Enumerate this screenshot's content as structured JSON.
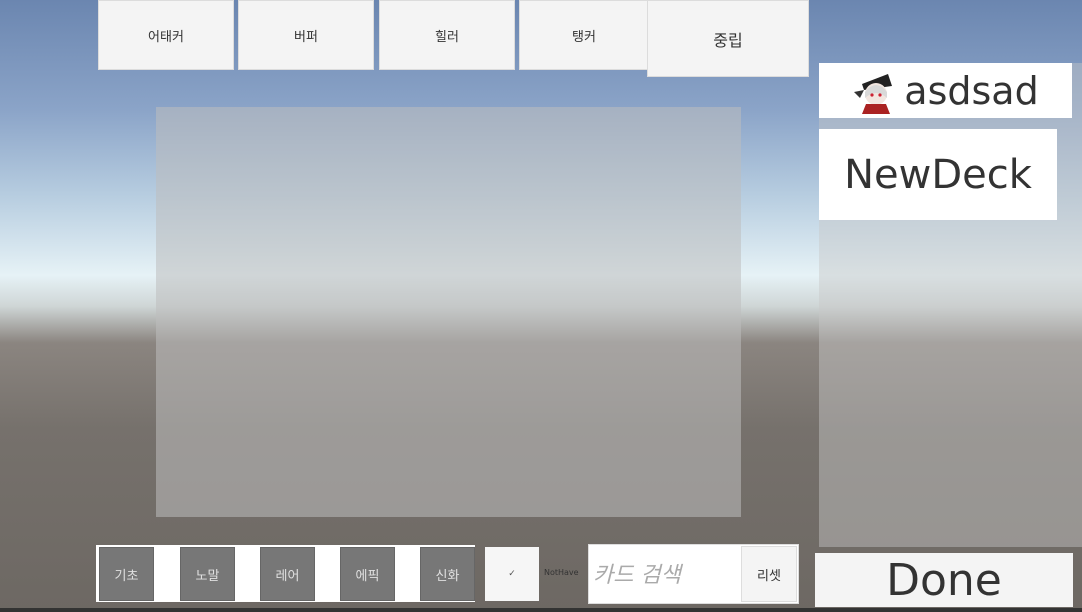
{
  "tabs": [
    {
      "label": "어태커"
    },
    {
      "label": "버퍼"
    },
    {
      "label": "힐러"
    },
    {
      "label": "탱커"
    },
    {
      "label": "중립"
    }
  ],
  "deck": {
    "name": "asdsad",
    "avatar_icon": "character-portrait-icon",
    "new_deck_label": "NewDeck"
  },
  "rarity_filters": [
    {
      "label": "기초"
    },
    {
      "label": "노말"
    },
    {
      "label": "레어"
    },
    {
      "label": "에픽"
    },
    {
      "label": "신화"
    }
  ],
  "not_have": {
    "check_mark": "✓",
    "label": "NotHave"
  },
  "search": {
    "placeholder": "카드 검색",
    "reset_label": "리셋"
  },
  "done_label": "Done"
}
